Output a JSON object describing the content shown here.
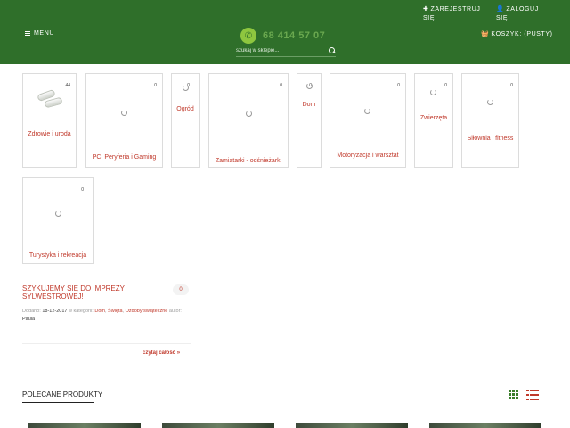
{
  "header": {
    "menu_label": "MENU",
    "register_label": "ZAREJESTRUJ SIĘ",
    "login_label": "ZALOGUJ SIĘ",
    "cart_label": "KOSZYK: (PUSTY)",
    "phone": "68 414 57 07",
    "search_placeholder": "szukaj w sklepie...",
    "bg_color": "#2f6f2a"
  },
  "categories": [
    {
      "name": "Zdrowie i uroda",
      "count": "44"
    },
    {
      "name": "PC, Peryferia i Gaming",
      "count": "0"
    },
    {
      "name": "Ogród",
      "count": "0"
    },
    {
      "name": "Zamiatarki - odśnieżarki",
      "count": "0"
    },
    {
      "name": "Dom",
      "count": "0"
    },
    {
      "name": "Motoryzacja i warsztat",
      "count": "0"
    },
    {
      "name": "Zwierzęta",
      "count": "0"
    },
    {
      "name": "Siłownia i fitness",
      "count": "0"
    },
    {
      "name": "Turystyka i rekreacja",
      "count": "0"
    }
  ],
  "post": {
    "title": "SZYKUJEMY SIĘ DO IMPREZY SYLWESTROWEJ!",
    "comments": "0",
    "added_label": "Dodano:",
    "date": "18-12-2017",
    "in_category_label": "w kategorii:",
    "cat1": "Dom",
    "cat2": "Święta",
    "cat3": "Ozdoby świąteczne",
    "author_label": "autor:",
    "author": "Paula",
    "read_more": "czytaj całość »"
  },
  "featured": {
    "title": "POLECANE PRODUKTY"
  },
  "colors": {
    "accent": "#c0392b",
    "green": "#3a7d2a"
  }
}
